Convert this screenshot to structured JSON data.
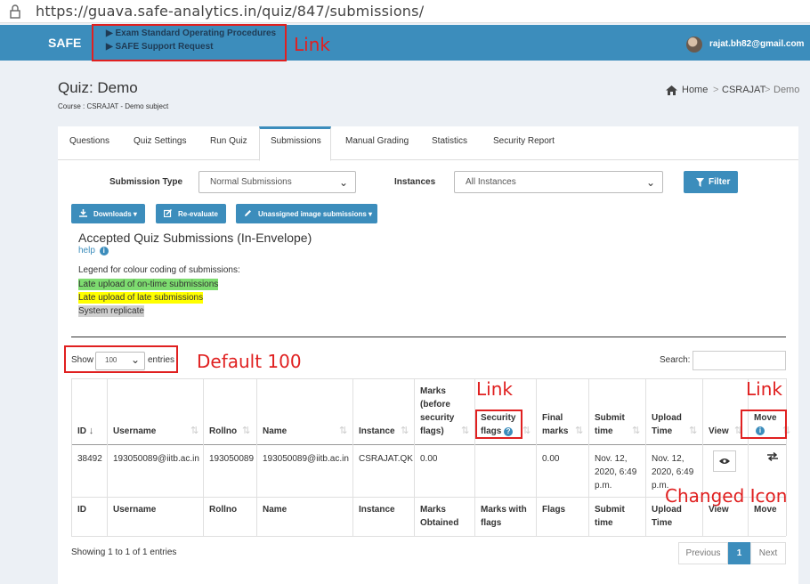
{
  "browser": {
    "url": "https://guava.safe-analytics.in/quiz/847/submissions/"
  },
  "navbar": {
    "logo": "SAFE",
    "links": [
      "▶ Exam Standard Operating Procedures",
      "▶ SAFE Support Request"
    ],
    "user_email": "rajat.bh82@gmail.com"
  },
  "annotations": {
    "link_top": "Link",
    "default_100": "Default 100",
    "link_security": "Link",
    "link_move": "Link",
    "changed_icon": "Changed Icon"
  },
  "page": {
    "title": "Quiz: Demo",
    "subtitle": "Course : CSRAJAT - Demo subject",
    "breadcrumb": [
      "Home",
      ">",
      "CSRAJAT",
      ">",
      "Demo"
    ]
  },
  "tabs": [
    "Questions",
    "Quiz Settings",
    "Run Quiz",
    "Submissions",
    "Manual Grading",
    "Statistics",
    "Security Report"
  ],
  "filters": {
    "submission_type_label": "Submission Type",
    "submission_type_value": "Normal Submissions",
    "instances_label": "Instances",
    "instances_value": "All Instances",
    "filter_button": "Filter"
  },
  "actions": {
    "downloads": "Downloads ▾",
    "reevaluate": "Re-evaluate",
    "unassigned": "Unassigned image submissions ▾"
  },
  "section": {
    "heading": "Accepted Quiz Submissions (In-Envelope)",
    "help": "help",
    "legend_title": "Legend for colour coding of submissions:",
    "legend": [
      {
        "text": "Late upload of on-time submissions",
        "color": "#7ddc6f"
      },
      {
        "text": "Late upload of late submissions",
        "color": "#ffff00"
      },
      {
        "text": "System replicate",
        "color": "#cfcfcf"
      }
    ]
  },
  "table_controls": {
    "show_label": "Show",
    "entries_value": "100",
    "entries_label": "entries",
    "search_label": "Search:"
  },
  "table": {
    "header": {
      "id": "ID",
      "username": "Username",
      "rollno": "Rollno",
      "name": "Name",
      "instance": "Instance",
      "marks": [
        "Marks",
        "(before",
        "security",
        "flags)"
      ],
      "security": [
        "Security",
        "flags"
      ],
      "final": [
        "Final",
        "marks"
      ],
      "submit": [
        "Submit",
        "time"
      ],
      "upload": [
        "Upload",
        "Time"
      ],
      "view": "View",
      "move": "Move"
    },
    "row": {
      "id": "38492",
      "username": "193050089@iitb.ac.in",
      "rollno": "193050089",
      "name": "193050089@iitb.ac.in",
      "instance": "CSRAJAT.QK",
      "marks": "0.00",
      "security": "",
      "final": "0.00",
      "submit": [
        "Nov. 12,",
        "2020, 6:49",
        "p.m."
      ],
      "upload": [
        "Nov. 12,",
        "2020, 6:49",
        "p.m."
      ]
    },
    "footer": {
      "id": "ID",
      "username": "Username",
      "rollno": "Rollno",
      "name": "Name",
      "instance": "Instance",
      "marks": [
        "Marks",
        "Obtained"
      ],
      "security": [
        "Marks with",
        "flags"
      ],
      "final": "Flags",
      "submit": [
        "Submit",
        "time"
      ],
      "upload": [
        "Upload",
        "Time"
      ],
      "view": "View",
      "move": "Move"
    }
  },
  "pagination": {
    "info": "Showing 1 to 1 of 1 entries",
    "previous": "Previous",
    "current": "1",
    "next": "Next"
  }
}
